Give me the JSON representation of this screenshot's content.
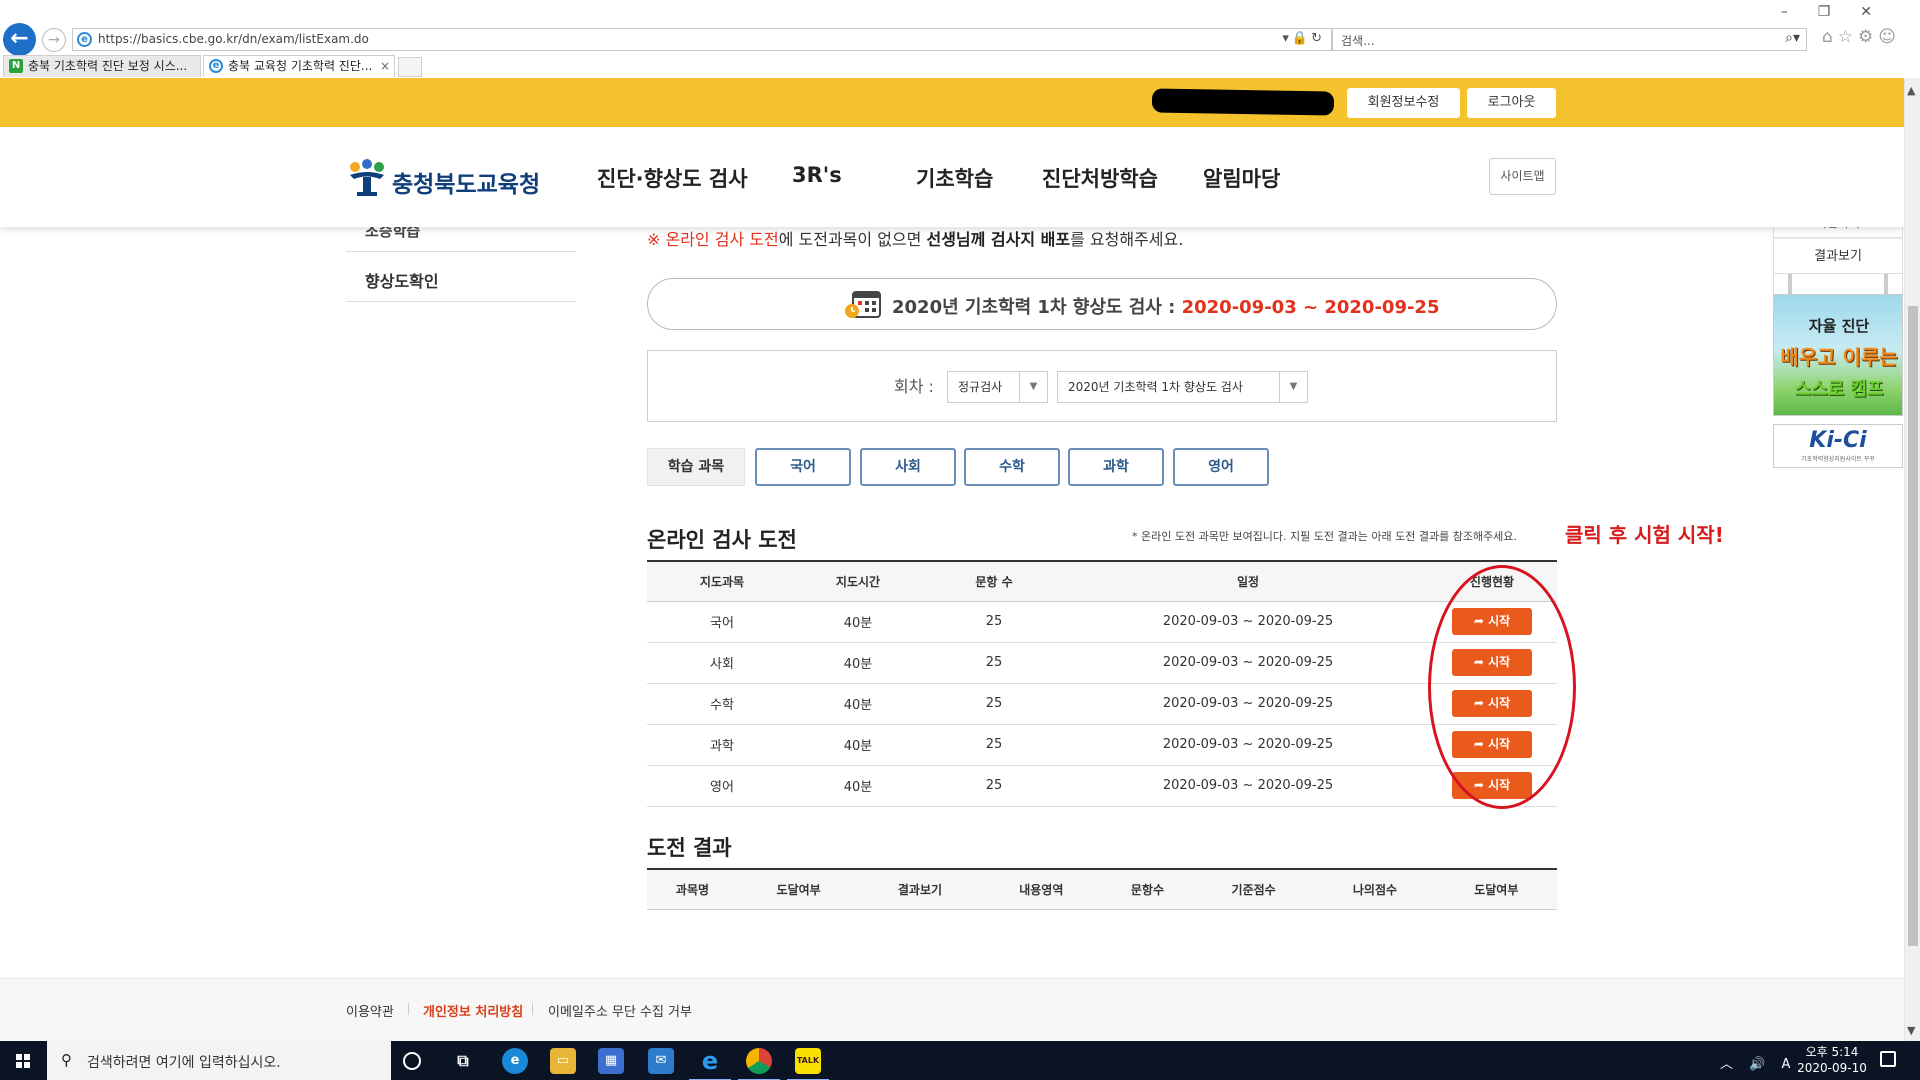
{
  "browser": {
    "url": "https://basics.cbe.go.kr/dn/exam/listExam.do",
    "search_placeholder": "검색...",
    "tabs": [
      {
        "label": "충북 기초학력 진단 보정 시스..."
      },
      {
        "label": "충북 교육청 기초학력 진단..."
      }
    ],
    "tab_close": "×"
  },
  "topbar": {
    "profile_button": "회원정보수정",
    "logout_button": "로그아웃"
  },
  "gnb": {
    "logo_text": "충청북도교육청",
    "items": [
      "진단·향상도 검사",
      "3R's",
      "기초학습",
      "진단처방학습",
      "알림마당"
    ],
    "sitemap": "사이트맵"
  },
  "lnb": {
    "partial_item": "조승학습",
    "item": "향상도확인"
  },
  "quick_menu": {
    "partial_item": "직접하기",
    "result_view": "결과보기",
    "banner1_line1": "자율 진단",
    "banner1_line2": "배우고 이루는",
    "banner1_line3": "스스로 캠프",
    "banner2_logo": "Ki-Ci",
    "banner2_sub": "기초학력향상지원사이트 꾸꾸"
  },
  "notice": {
    "red_part": "※ 온라인 검사 도전",
    "part2": "에 도전과목이 없으면 ",
    "bold_part": "선생님께 검사지 배포",
    "part3": "를 요청해주세요."
  },
  "period": {
    "title": "2020년 기초학력 1차 향상도 검사 : ",
    "range": "2020-09-03 ~ 2020-09-25"
  },
  "session": {
    "label": "회차 :",
    "type_select": "정규검사",
    "exam_select": "2020년 기초학력 1차 향상도 검사",
    "arrow": "▼"
  },
  "subjects": {
    "label": "학습 과목",
    "buttons": [
      "국어",
      "사회",
      "수학",
      "과학",
      "영어"
    ]
  },
  "online": {
    "title": "온라인 검사 도전",
    "note": "* 온라인 도전 과목만 보여집니다. 지필 도전 결과는 아래 도전 결과를 참조해주세요.",
    "annotation": "클릭 후 시험 시작!",
    "headers": [
      "지도과목",
      "지도시간",
      "문항 수",
      "일정",
      "진행현황"
    ],
    "start_label": "시작",
    "start_icon": "➦",
    "rows": [
      {
        "subject": "국어",
        "time": "40분",
        "count": "25",
        "schedule": "2020-09-03 ~ 2020-09-25"
      },
      {
        "subject": "사회",
        "time": "40분",
        "count": "25",
        "schedule": "2020-09-03 ~ 2020-09-25"
      },
      {
        "subject": "수학",
        "time": "40분",
        "count": "25",
        "schedule": "2020-09-03 ~ 2020-09-25"
      },
      {
        "subject": "과학",
        "time": "40분",
        "count": "25",
        "schedule": "2020-09-03 ~ 2020-09-25"
      },
      {
        "subject": "영어",
        "time": "40분",
        "count": "25",
        "schedule": "2020-09-03 ~ 2020-09-25"
      }
    ]
  },
  "result": {
    "title": "도전 결과",
    "headers": [
      "과목명",
      "도달여부",
      "결과보기",
      "내용영역",
      "문항수",
      "기준점수",
      "나의점수",
      "도달여부"
    ]
  },
  "footer": {
    "terms": "이용약관",
    "privacy": "개인정보 처리방침",
    "email": "이메일주소 무단 수집 거부"
  },
  "taskbar": {
    "search_placeholder": "검색하려면 여기에 입력하십시오.",
    "tray": "︿ 🔊 A",
    "time": "오후 5:14",
    "date": "2020-09-10"
  },
  "colors": {
    "topbar_yellow": "#f4c22c",
    "accent_red": "#e2311d",
    "start_orange": "#ea5a1c",
    "logo_navy": "#0f3f7b"
  }
}
